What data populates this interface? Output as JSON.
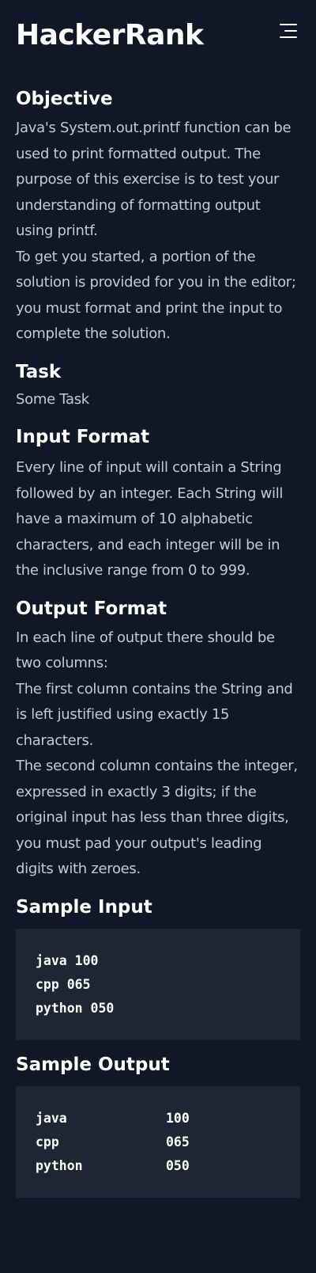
{
  "header": {
    "brand": "HackerRank",
    "menu_icon": "hamburger-menu-icon"
  },
  "objective": {
    "heading": "Objective",
    "paragraph1": "Java's System.out.printf function can be used to print formatted output. The purpose of this exercise is to test your understanding of formatting output using printf.",
    "paragraph2": "To get you started, a portion of the solution is provided for you in the editor; you must format and print the input to complete the solution."
  },
  "task": {
    "heading": "Task",
    "text": "Some Task"
  },
  "input_format": {
    "heading": "Input Format",
    "text": "Every line of input will contain a String followed by an integer. Each String will have a maximum of 10 alphabetic characters, and each integer will be in the inclusive range from 0 to 999."
  },
  "output_format": {
    "heading": "Output Format",
    "paragraph1": "In each line of output there should be two columns:",
    "paragraph2": "The first column contains the String and is left justified using exactly 15 characters.",
    "paragraph3": "The second column contains the integer, expressed in exactly 3 digits; if the original input has less than three digits, you must pad your output's leading digits with zeroes."
  },
  "sample_input": {
    "heading": "Sample Input",
    "lines": [
      "java 100",
      "cpp 065",
      "python 050"
    ]
  },
  "sample_output": {
    "heading": "Sample Output",
    "rows": [
      {
        "name": "java",
        "value": "100"
      },
      {
        "name": "cpp",
        "value": "065"
      },
      {
        "name": "python",
        "value": "050"
      }
    ]
  }
}
